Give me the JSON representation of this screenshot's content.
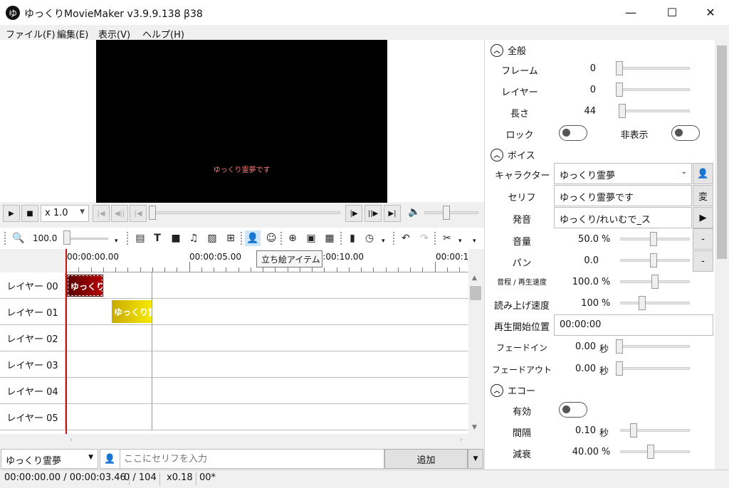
{
  "window": {
    "title": "ゆっくりMovieMaker v3.9.9.138 β38",
    "icon_letter": "ゆ",
    "min": "—",
    "max": "☐",
    "close": "✕"
  },
  "menu": [
    "ファイル(F)",
    "編集(E)",
    "表示(V)",
    "ヘルプ(H)"
  ],
  "preview": {
    "subtitle": "ゆっくり霊夢です"
  },
  "transport": {
    "speed": "x 1.0",
    "volume_pct": 40,
    "seek_pct": 0
  },
  "toolbar": {
    "zoom": "100.0",
    "tooltip": "立ち絵アイテム"
  },
  "timeline": {
    "ticks": [
      "00:00:00.00",
      "00:00:05.00",
      "00:00:10.00",
      "00:00:1"
    ],
    "layers": [
      "レイヤー 00",
      "レイヤー 01",
      "レイヤー 02",
      "レイヤー 03",
      "レイヤー 04",
      "レイヤー 05"
    ],
    "clip_red": "ゆっくり",
    "clip_yellow": "ゆっくり霊"
  },
  "bottom": {
    "character": "ゆっくり霊夢",
    "placeholder": "ここにセリフを入力",
    "add": "追加"
  },
  "status": [
    "00:00:00.00  /  00:00:03.46",
    "0  /  104",
    "x0.18",
    "00*"
  ],
  "panel": {
    "general": {
      "title": "全般",
      "frame_label": "フレーム",
      "frame": "0",
      "layer_label": "レイヤー",
      "layer": "0",
      "length_label": "長さ",
      "length": "44",
      "lock_label": "ロック",
      "hide_label": "非表示"
    },
    "voice": {
      "title": "ボイス",
      "character_label": "キャラクター",
      "character": "ゆっくり霊夢",
      "serif_label": "セリフ",
      "serif": "ゆっくり霊夢です",
      "serif_btn": "変",
      "pron_label": "発音",
      "pron": "ゆっくり/れいむで_ス",
      "volume_label": "音量",
      "volume": "50.0",
      "volume_unit": "%",
      "pan_label": "パン",
      "pan": "0.0",
      "pitch_label": "音程 / 再生速度",
      "pitch": "100.0",
      "pitch_unit": "%",
      "read_label": "読み上げ速度",
      "read": "100",
      "read_unit": "%",
      "start_label": "再生開始位置",
      "start": "00:00:00",
      "fadein_label": "フェードイン",
      "fadein": "0.00",
      "fadein_unit": "秒",
      "fadeout_label": "フェードアウト",
      "fadeout": "0.00",
      "fadeout_unit": "秒",
      "minus": "-"
    },
    "echo": {
      "title": "エコー",
      "enabled_label": "有効",
      "interval_label": "間隔",
      "interval": "0.10",
      "interval_unit": "秒",
      "decay_label": "減衰",
      "decay": "40.00",
      "decay_unit": "%"
    }
  }
}
